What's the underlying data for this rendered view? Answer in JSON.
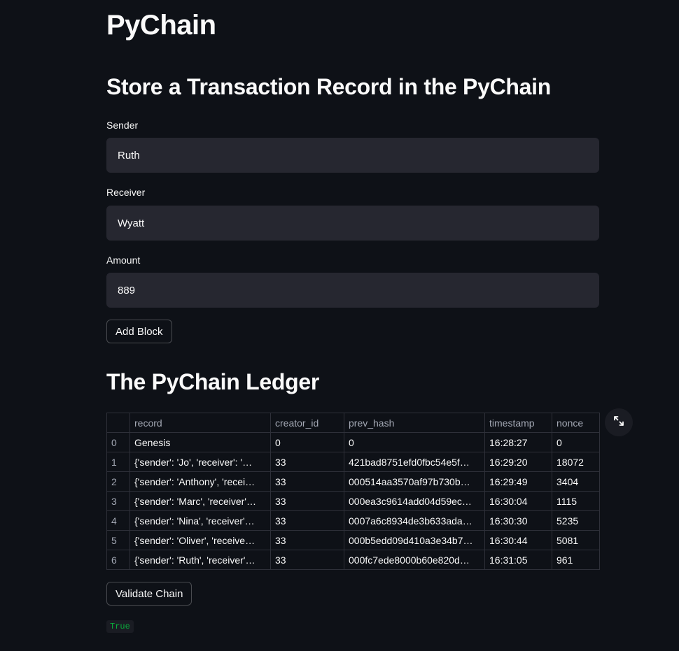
{
  "app": {
    "title": "PyChain"
  },
  "form": {
    "heading": "Store a Transaction Record in the PyChain",
    "sender": {
      "label": "Sender",
      "value": "Ruth"
    },
    "receiver": {
      "label": "Receiver",
      "value": "Wyatt"
    },
    "amount": {
      "label": "Amount",
      "value": "889"
    },
    "add_block_label": "Add Block"
  },
  "ledger": {
    "heading": "The PyChain Ledger",
    "columns": [
      "",
      "record",
      "creator_id",
      "prev_hash",
      "timestamp",
      "nonce"
    ],
    "rows": [
      [
        "0",
        "Genesis",
        "0",
        "0",
        "16:28:27",
        "0"
      ],
      [
        "1",
        "{'sender': 'Jo', 'receiver': '…",
        "33",
        "421bad8751efd0fbc54e5f…",
        "16:29:20",
        "18072"
      ],
      [
        "2",
        "{'sender': 'Anthony', 'recei…",
        "33",
        "000514aa3570af97b730b…",
        "16:29:49",
        "3404"
      ],
      [
        "3",
        "{'sender': 'Marc', 'receiver'…",
        "33",
        "000ea3c9614add04d59ec…",
        "16:30:04",
        "1115"
      ],
      [
        "4",
        "{'sender': 'Nina', 'receiver'…",
        "33",
        "0007a6c8934de3b633ada…",
        "16:30:30",
        "5235"
      ],
      [
        "5",
        "{'sender': 'Oliver', 'receive…",
        "33",
        "000b5edd09d410a3e34b7…",
        "16:30:44",
        "5081"
      ],
      [
        "6",
        "{'sender': 'Ruth', 'receiver'…",
        "33",
        "000fc7ede8000b60e820d…",
        "16:31:05",
        "961"
      ]
    ],
    "expand_icon": "expand-icon"
  },
  "validate": {
    "button_label": "Validate Chain",
    "result": "True"
  },
  "colors": {
    "background": "#0e1117",
    "input_bg": "#262730",
    "success_text": "#09ab3b"
  }
}
